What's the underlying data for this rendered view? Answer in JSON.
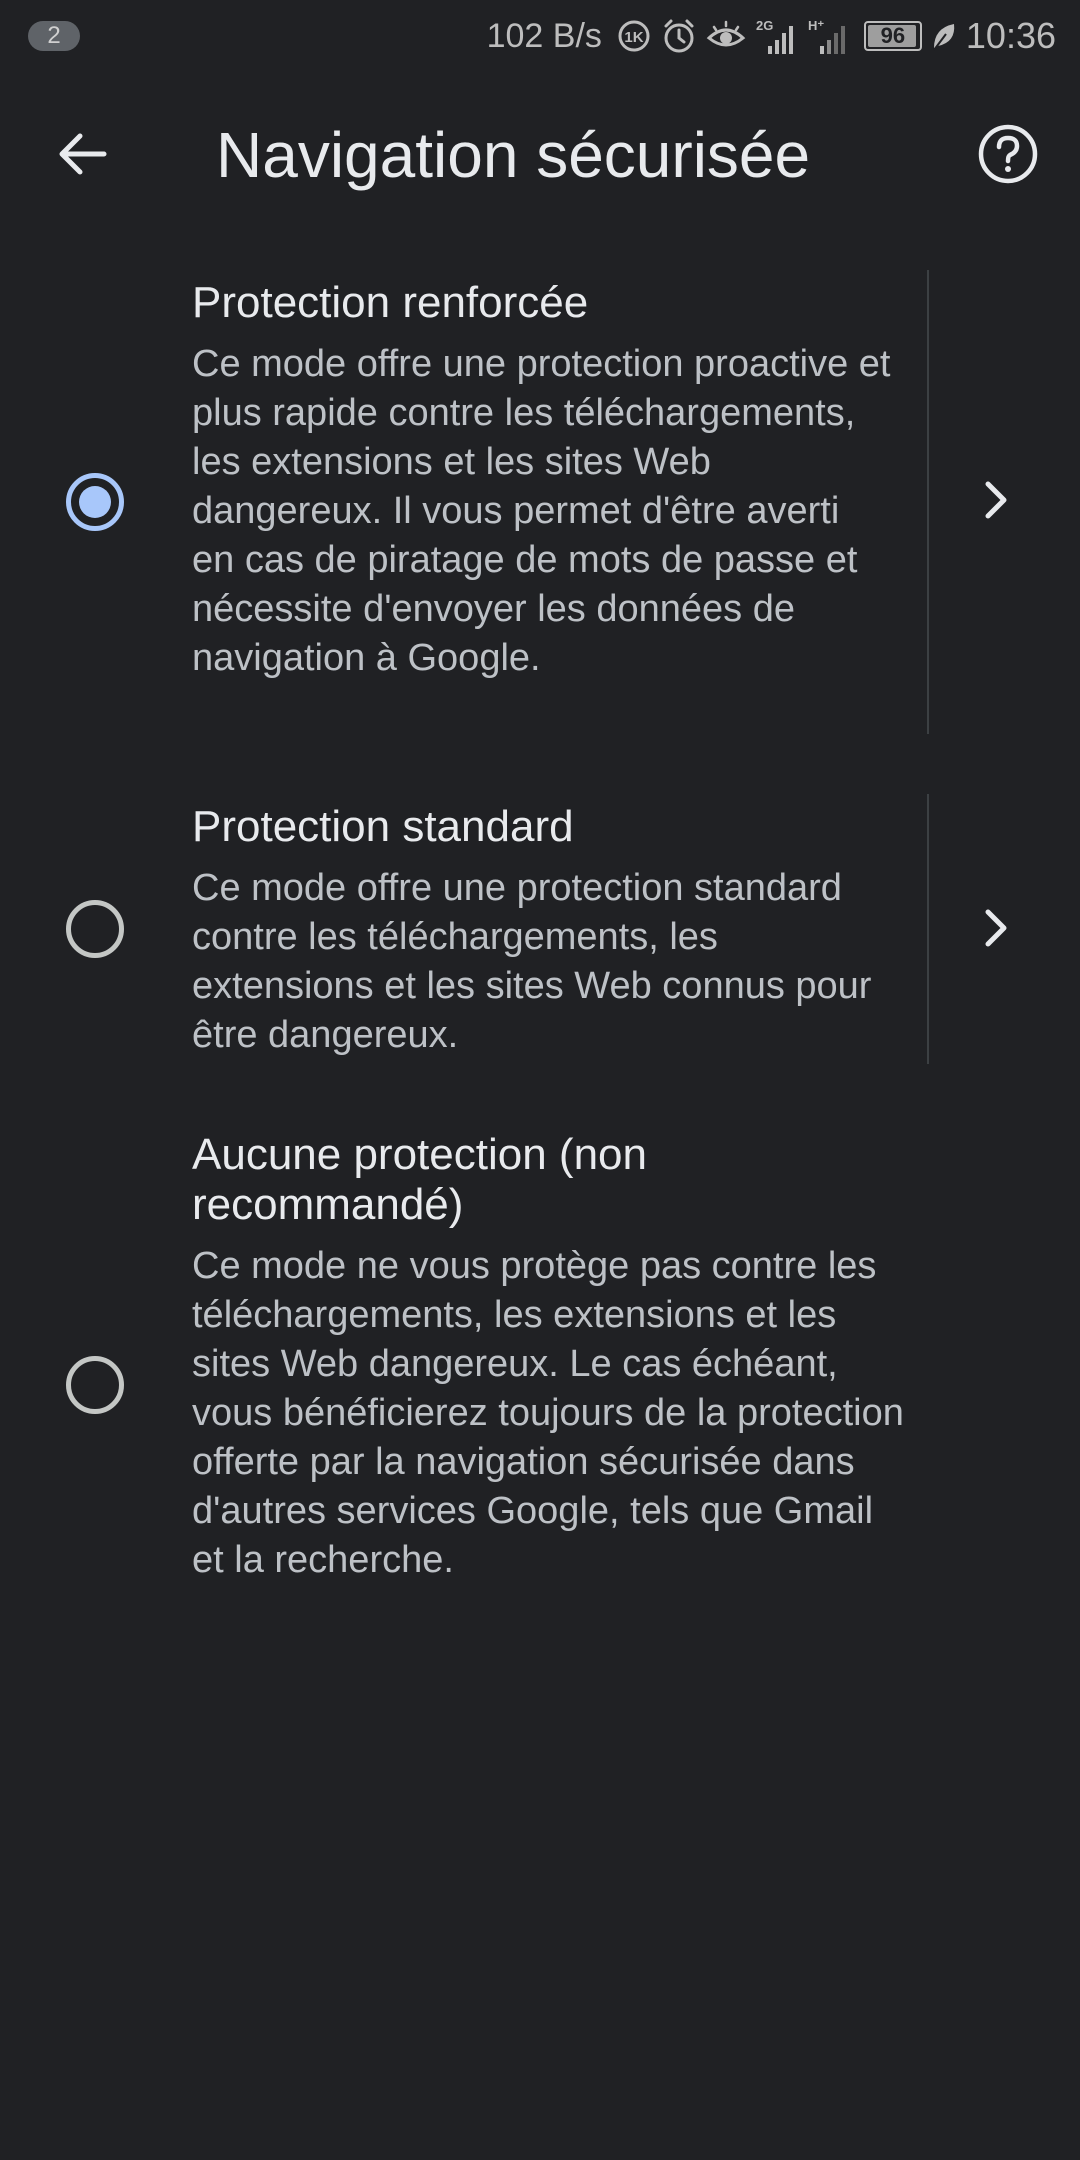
{
  "status_bar": {
    "notification_count": "2",
    "net_speed": "102 B/s",
    "network_2g": "2G",
    "network_h": "H⁺",
    "battery": "96",
    "time": "10:36",
    "icons": [
      "data-saver-icon",
      "alarm-icon",
      "eye-comfort-icon",
      "signal-2g-icon",
      "signal-h-icon",
      "battery-icon",
      "leaf-icon"
    ]
  },
  "toolbar": {
    "back_icon": "arrow-left-icon",
    "title": "Navigation sécurisée",
    "help_icon": "help-circle-icon"
  },
  "options": [
    {
      "title": "Protection renforcée",
      "description": "Ce mode offre une protection proactive et plus rapide contre les téléchargements, les extensions et les sites Web dangereux. Il vous permet d'être averti en cas de piratage de mots de passe et nécessite d'envoyer les données de navigation à Google.",
      "selected": true,
      "has_details": true
    },
    {
      "title": "Protection standard",
      "description": "Ce mode offre une protection standard contre les téléchargements, les extensions et les sites Web connus pour être dangereux.",
      "selected": false,
      "has_details": true
    },
    {
      "title": "Aucune protection (non recommandé)",
      "description": "Ce mode ne vous protège pas contre les téléchargements, les extensions et les sites Web dangereux. Le cas échéant, vous bénéficierez toujours de la protection offerte par la navigation sécurisée dans d'autres services Google, tels que Gmail et la recherche.",
      "selected": false,
      "has_details": false
    }
  ],
  "colors": {
    "background": "#202124",
    "accent": "#a8c7fa",
    "text_primary": "#e8eaed",
    "text_secondary": "#bdc1c6"
  }
}
